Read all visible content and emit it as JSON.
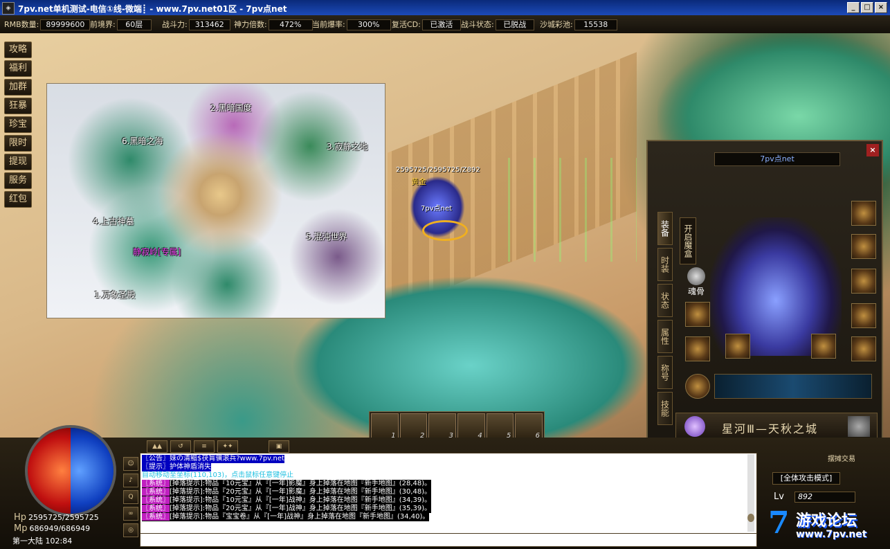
{
  "window": {
    "title": "7pv.net单机测试-电信①线-微端┋ - www.7pv.net01区 - 7pv点net",
    "icon": "game-icon"
  },
  "stats": [
    {
      "label": "RMB数量:",
      "value": "89999600"
    },
    {
      "label": "前境界:",
      "value": "60层"
    },
    {
      "label": "战斗力:",
      "value": "313462"
    },
    {
      "label": "神力倍数:",
      "value": "472%"
    },
    {
      "label": "当前爆率:",
      "value": "300%"
    },
    {
      "label": "复活CD:",
      "value": "已激活"
    },
    {
      "label": "战斗状态:",
      "value": "已脱战"
    },
    {
      "label": "沙城彩池:",
      "value": "15538"
    }
  ],
  "side_menu": [
    "攻略",
    "福利",
    "加群",
    "狂暴",
    "珍宝",
    "限时",
    "提现",
    "服务",
    "红包"
  ],
  "minimap": {
    "labels": [
      {
        "text": "2.黑暗国度"
      },
      {
        "text": "6.黑暗之海"
      },
      {
        "text": "3.寂静之地"
      },
      {
        "text": "4.上古神墓"
      },
      {
        "text": "5.混沌世界"
      },
      {
        "text": "静寂岭[专属]"
      },
      {
        "text": "1.万象圣殿"
      }
    ]
  },
  "hero": {
    "hp_text": "2595725/2595725/Z892",
    "title": "黄金",
    "name": "7pv点net"
  },
  "hotbar": [
    "1",
    "2",
    "3",
    "4",
    "5",
    "6"
  ],
  "equipment": {
    "title": "7pv点net",
    "close": "×",
    "tabs": [
      "装备",
      "时装",
      "状态",
      "属性",
      "称号",
      "技能"
    ],
    "magic_box": "开启魔盒",
    "soul": "魂骨",
    "zone_name": "星河Ⅲ—天秋之城"
  },
  "chat": {
    "lines": [
      {
        "type": "notice",
        "text": "〖公告〗妹の清黯$茯肓骥滚兵?www.7pv.net"
      },
      {
        "type": "info",
        "text": "〖提示〗护体神盾消失"
      },
      {
        "type": "cyan",
        "text": "自动移动至坐标(110,103)，点击鼠标任意键停止"
      },
      {
        "type": "sys",
        "tag": "〖系统〗",
        "text": "[掉落提示]:物品『10元宝』从『[一年]影魔』身上掉落在地图『新手地图』(28,48)。"
      },
      {
        "type": "sys",
        "tag": "〖系统〗",
        "text": "[掉落提示]:物品『20元宝』从『[一年]影魔』身上掉落在地图『新手地图』(30,48)。"
      },
      {
        "type": "sys",
        "tag": "〖系统〗",
        "text": "[掉落提示]:物品『10元宝』从『[一年]战神』身上掉落在地图『新手地图』(34,39)。"
      },
      {
        "type": "sys",
        "tag": "〖系统〗",
        "text": "[掉落提示]:物品『20元宝』从『[一年]战神』身上掉落在地图『新手地图』(35,39)。"
      },
      {
        "type": "sys",
        "tag": "〖系统〗",
        "text": "[掉落提示]:物品『宝宝卷』从『[一年]战神』身上掉落在地图『新手地图』(34,40)。"
      }
    ],
    "side_buttons": [
      "☺",
      "♪",
      "Q",
      "∞",
      "◎"
    ],
    "top_tabs": [
      "▲▲",
      "↺",
      "≡",
      "✦✦",
      "▣"
    ]
  },
  "vitals": {
    "hp_label": "Hp",
    "hp": "2595725/2595725",
    "mp_label": "Mp",
    "mp": "686949/686949"
  },
  "location": "第一大陆 102:84",
  "attack_mode": "[全体攻击模式]",
  "level": {
    "label": "Lv",
    "value": "892"
  },
  "corner_button": "摆摊交易",
  "brand": {
    "seven": "7",
    "name": "游戏论坛",
    "url": "www.7pv.net"
  }
}
